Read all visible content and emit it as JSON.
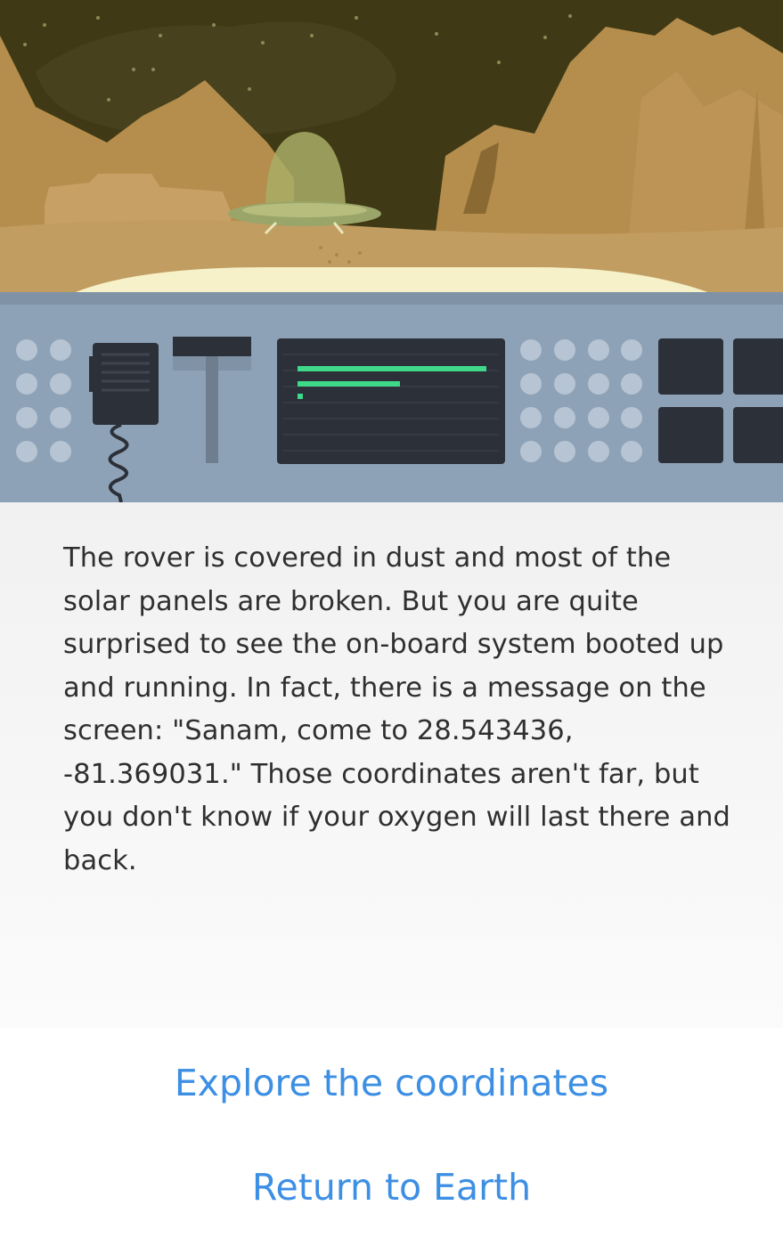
{
  "story": {
    "text": "The rover is covered in dust and most of the solar panels are broken. But you are quite surprised to see the on-board system booted up and running. In fact, there is a message on the screen: \"Sanam, come to 28.543436, -81.369031.\" Those coordinates aren't far, but you don't know if your oxygen will last there and back."
  },
  "choices": [
    {
      "label": "Explore the coordinates"
    },
    {
      "label": "Return to Earth"
    }
  ],
  "colors": {
    "sky": "#3f3a15",
    "rock": "#b38c4e",
    "ground": "#c19d62",
    "dashboard": "#8ea2b7",
    "screen": "#2c3038",
    "screen_text": "#3fd98a",
    "choice_text": "#3d8fe4"
  }
}
